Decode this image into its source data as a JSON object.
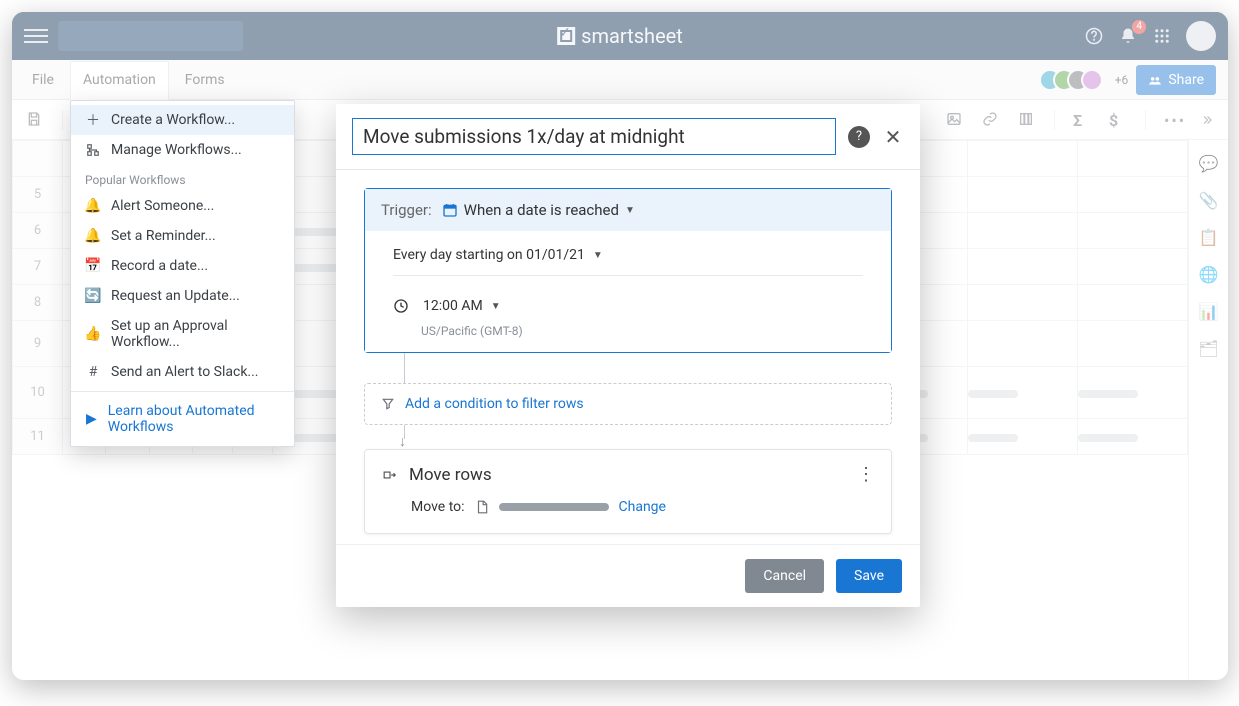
{
  "brand": "smartsheet",
  "topbar": {
    "notif_count": "4"
  },
  "secbar": {
    "tabs": {
      "file": "File",
      "automation": "Automation",
      "forms": "Forms"
    },
    "plus_more": "+6",
    "share": "Share"
  },
  "automation_menu": {
    "create": "Create a Workflow...",
    "manage": "Manage Workflows...",
    "section": "Popular Workflows",
    "alert": "Alert Someone...",
    "reminder": "Set a Reminder...",
    "record_date": "Record a date...",
    "request_update": "Request an Update...",
    "approval": "Set up an Approval Workflow...",
    "slack": "Send an Alert to Slack...",
    "learn": "Learn about Automated Workflows"
  },
  "modal": {
    "name": "Move submissions 1x/day at midnight",
    "trigger_label": "Trigger:",
    "trigger_type": "When a date is reached",
    "schedule": "Every day starting on 01/01/21",
    "time": "12:00 AM",
    "tz": "US/Pacific (GMT-8)",
    "condition": "Add a condition to filter rows",
    "action_title": "Move rows",
    "move_to_label": "Move to:",
    "change": "Change",
    "cancel": "Cancel",
    "save": "Save"
  },
  "rows": [
    "5",
    "6",
    "7",
    "8",
    "9",
    "10",
    "11"
  ]
}
